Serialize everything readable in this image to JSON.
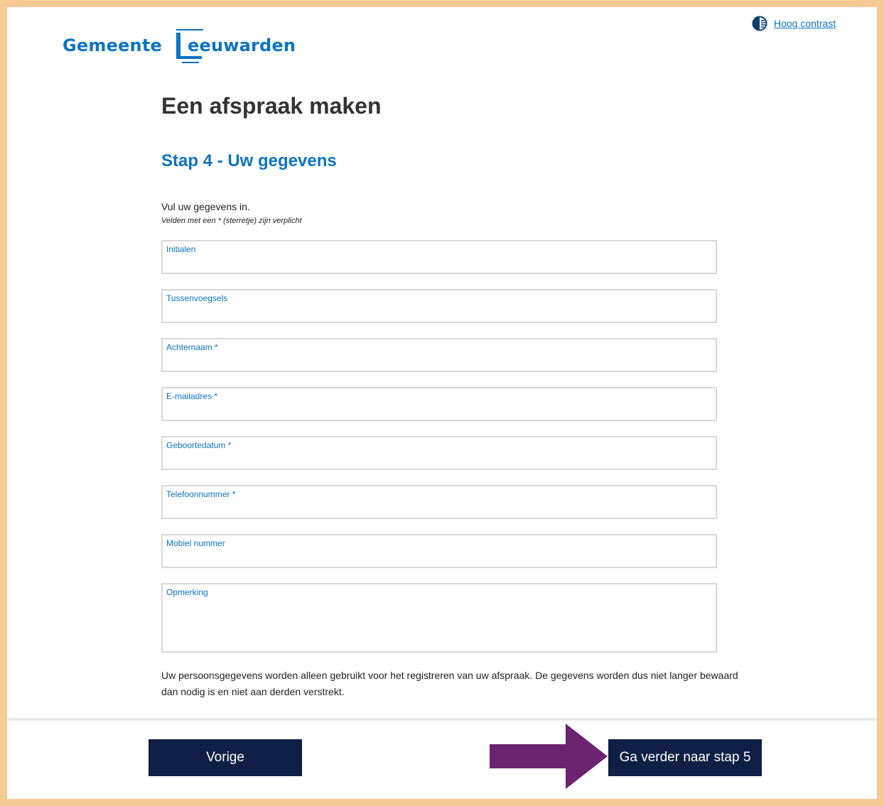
{
  "header": {
    "logo_word1": "Gemeente",
    "logo_word2": "eeuwarden",
    "contrast_label": "Hoog contrast",
    "contrast_icon": "contrast-icon"
  },
  "main": {
    "page_title": "Een afspraak maken",
    "step_title": "Stap 4 - Uw gegevens",
    "intro": "Vul uw gegevens in.",
    "required_note": "Velden met een * (sterretje) zijn verplicht",
    "fields": [
      {
        "label": "Initialen",
        "value": ""
      },
      {
        "label": "Tussenvoegsels",
        "value": ""
      },
      {
        "label": "Achternaam *",
        "value": ""
      },
      {
        "label": "E-mailadres *",
        "value": ""
      },
      {
        "label": "Geboortedatum *",
        "value": ""
      },
      {
        "label": "Telefoonnummer *",
        "value": ""
      },
      {
        "label": "Mobiel nummer",
        "value": ""
      },
      {
        "label": "Opmerking",
        "value": ""
      }
    ],
    "privacy_text": "Uw persoonsgegevens worden alleen gebruikt voor het registreren van uw afspraak. De gegevens worden dus niet langer bewaard dan nodig is en niet aan derden verstrekt."
  },
  "footer": {
    "prev_label": "Vorige",
    "next_label": "Ga verder naar stap 5"
  },
  "colors": {
    "brand_blue": "#0d73c3",
    "button_navy": "#0f1f45",
    "frame_orange": "#f7c994",
    "arrow_purple": "#6b2372"
  }
}
